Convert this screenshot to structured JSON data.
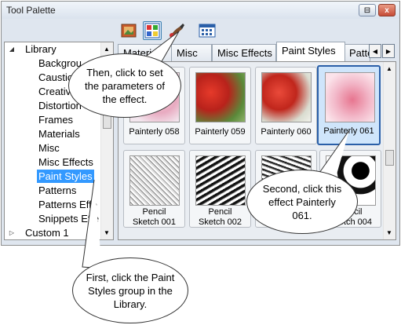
{
  "window": {
    "title": "Tool Palette",
    "pin_icon": "pin-icon",
    "close_label": "x"
  },
  "toolbar": {
    "tools": [
      {
        "name": "materials-tool",
        "icon": "landscape-picture-icon"
      },
      {
        "name": "effects-tool",
        "icon": "palette-grid-icon",
        "selected": true
      },
      {
        "name": "effect-parameters-tool",
        "icon": "paint-brush-icon"
      },
      {
        "name": "layout-tool",
        "icon": "layout-icon"
      }
    ]
  },
  "tree": {
    "items": [
      {
        "label": "Library",
        "expanded": true
      },
      {
        "label": "Backgrou"
      },
      {
        "label": "Caustics"
      },
      {
        "label": "Creative"
      },
      {
        "label": "Distortion"
      },
      {
        "label": "Frames"
      },
      {
        "label": "Materials"
      },
      {
        "label": "Misc"
      },
      {
        "label": "Misc Effects"
      },
      {
        "label": "Paint Styles",
        "selected": true
      },
      {
        "label": "Patterns"
      },
      {
        "label": "Patterns Effe"
      },
      {
        "label": "Snippets Effe"
      },
      {
        "label": "Custom 1",
        "expanded": false
      }
    ]
  },
  "tabs": {
    "items": [
      "Material",
      "Misc",
      "Misc Effects",
      "Paint Styles",
      "Patte"
    ],
    "active": "Paint Styles"
  },
  "thumbnails": [
    {
      "line1": "Painterly 058",
      "line2": ""
    },
    {
      "line1": "Painterly 059",
      "line2": ""
    },
    {
      "line1": "Painterly 060",
      "line2": ""
    },
    {
      "line1": "Painterly 061",
      "line2": "",
      "selected": true
    },
    {
      "line1": "Pencil",
      "line2": "Sketch 001"
    },
    {
      "line1": "Pencil",
      "line2": "Sketch 002"
    },
    {
      "line1": "",
      "line2": ""
    },
    {
      "line1": "Pencil",
      "line2": "Sketch 004"
    }
  ],
  "callouts": {
    "first": "First, click the Paint Styles group in the Library.",
    "second": "Second, click this effect Painterly 061.",
    "then": "Then, click to set the parameters of the effect."
  }
}
